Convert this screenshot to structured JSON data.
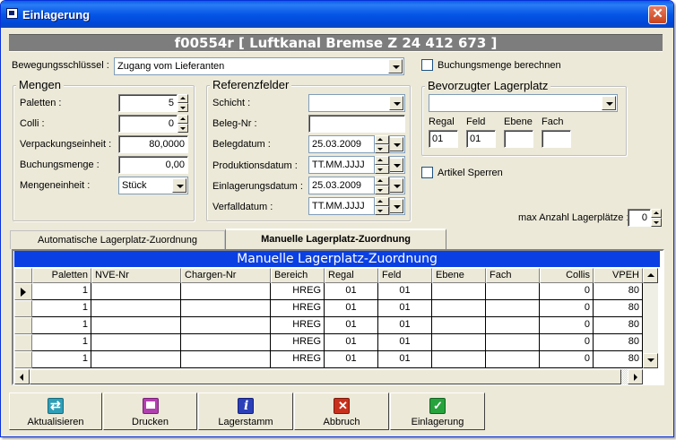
{
  "window": {
    "title": "Einlagerung",
    "close_symbol": "✕"
  },
  "header": {
    "text": "f00554r [ Luftkanal Bremse Z 24 412 673 ]"
  },
  "bewegung": {
    "label": "Bewegungsschlüssel :",
    "value": "Zugang vom Lieferanten"
  },
  "buchungsmenge_berechnen": {
    "label": "Buchungsmenge berechnen",
    "checked": false
  },
  "mengen": {
    "title": "Mengen",
    "paletten": {
      "label": "Paletten :",
      "value": "5"
    },
    "colli": {
      "label": "Colli :",
      "value": "0"
    },
    "verpackungseinheit": {
      "label": "Verpackungseinheit :",
      "value": "80,0000"
    },
    "buchungsmenge": {
      "label": "Buchungsmenge :",
      "value": "0,00"
    },
    "mengeneinheit": {
      "label": "Mengeneinheit :",
      "value": "Stück"
    }
  },
  "referenz": {
    "title": "Referenzfelder",
    "schicht": {
      "label": "Schicht :",
      "value": ""
    },
    "beleg_nr": {
      "label": "Beleg-Nr :",
      "value": ""
    },
    "belegdatum": {
      "label": "Belegdatum :",
      "value": "25.03.2009"
    },
    "produktionsdatum": {
      "label": "Produktionsdatum :",
      "value": "TT.MM.JJJJ"
    },
    "einlagerungsdatum": {
      "label": "Einlagerungsdatum :",
      "value": "25.03.2009"
    },
    "verfalldatum": {
      "label": "Verfalldatum :",
      "value": "TT.MM.JJJJ"
    }
  },
  "lagerplatz": {
    "title": "Bevorzugter Lagerplatz",
    "dropdown_value": "",
    "regal": {
      "label": "Regal",
      "value": "01"
    },
    "feld": {
      "label": "Feld",
      "value": "01"
    },
    "ebene": {
      "label": "Ebene",
      "value": ""
    },
    "fach": {
      "label": "Fach",
      "value": ""
    }
  },
  "artikel_sperren": {
    "label": "Artikel Sperren",
    "checked": false
  },
  "max_anzahl": {
    "label": "max Anzahl Lagerplätze :",
    "value": "0"
  },
  "tabs": [
    {
      "label": "Automatische Lagerplatz-Zuordnung",
      "active": false
    },
    {
      "label": "Manuelle Lagerplatz-Zuordnung",
      "active": true
    }
  ],
  "grid": {
    "title": "Manuelle Lagerplatz-Zuordnung",
    "columns": [
      "Paletten",
      "NVE-Nr",
      "Chargen-Nr",
      "Bereich",
      "Regal",
      "Feld",
      "Ebene",
      "Fach",
      "Collis",
      "VPEH"
    ],
    "rows": [
      [
        "1",
        "",
        "",
        "HREG",
        "01",
        "01",
        "",
        "",
        "0",
        "80"
      ],
      [
        "1",
        "",
        "",
        "HREG",
        "01",
        "01",
        "",
        "",
        "0",
        "80"
      ],
      [
        "1",
        "",
        "",
        "HREG",
        "01",
        "01",
        "",
        "",
        "0",
        "80"
      ],
      [
        "1",
        "",
        "",
        "HREG",
        "01",
        "01",
        "",
        "",
        "0",
        "80"
      ],
      [
        "1",
        "",
        "",
        "HREG",
        "01",
        "01",
        "",
        "",
        "0",
        "80"
      ]
    ]
  },
  "buttons": [
    {
      "label": "Aktualisieren",
      "icon": "refresh-icon",
      "color": "#2f9fb8"
    },
    {
      "label": "Drucken",
      "icon": "printer-icon",
      "color": "#b23fb0"
    },
    {
      "label": "Lagerstamm",
      "icon": "info-icon",
      "color": "#2b3fb8"
    },
    {
      "label": "Abbruch",
      "icon": "cancel-icon",
      "color": "#c9301c"
    },
    {
      "label": "Einlagerung",
      "icon": "check-icon",
      "color": "#27a33c"
    }
  ]
}
